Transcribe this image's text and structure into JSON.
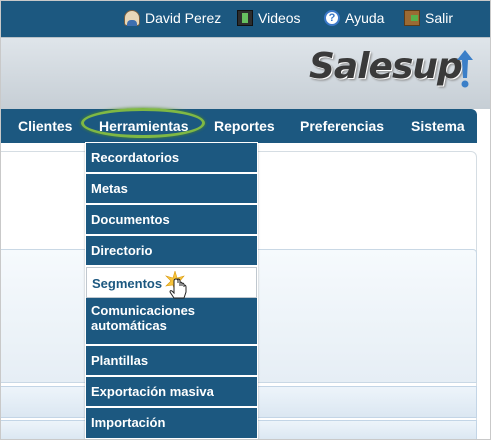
{
  "topbar": {
    "user": {
      "label": "David Perez",
      "icon": "user-icon"
    },
    "videos": {
      "label": "Videos",
      "icon": "film-icon"
    },
    "help": {
      "label": "Ayuda",
      "icon": "help-icon"
    },
    "exit": {
      "label": "Salir",
      "icon": "exit-door-icon"
    }
  },
  "logo": {
    "text": "Salesup",
    "accent_color": "#3b7fc8"
  },
  "nav": {
    "items": [
      {
        "label": "Clientes"
      },
      {
        "label": "Herramientas",
        "active": true
      },
      {
        "label": "Reportes"
      },
      {
        "label": "Preferencias"
      },
      {
        "label": "Sistema"
      }
    ]
  },
  "dropdown": {
    "items": [
      {
        "label": "Recordatorios"
      },
      {
        "label": "Metas"
      },
      {
        "label": "Documentos"
      },
      {
        "label": "Directorio"
      },
      {
        "label": "Segmentos",
        "hovered": true
      },
      {
        "label": "Comunicaciones automáticas"
      },
      {
        "label": "Plantillas"
      },
      {
        "label": "Exportación masiva"
      },
      {
        "label": "Importación"
      }
    ]
  },
  "colors": {
    "primary": "#1c5880",
    "highlight_ring": "#7fb844",
    "background": "#ffffff"
  }
}
